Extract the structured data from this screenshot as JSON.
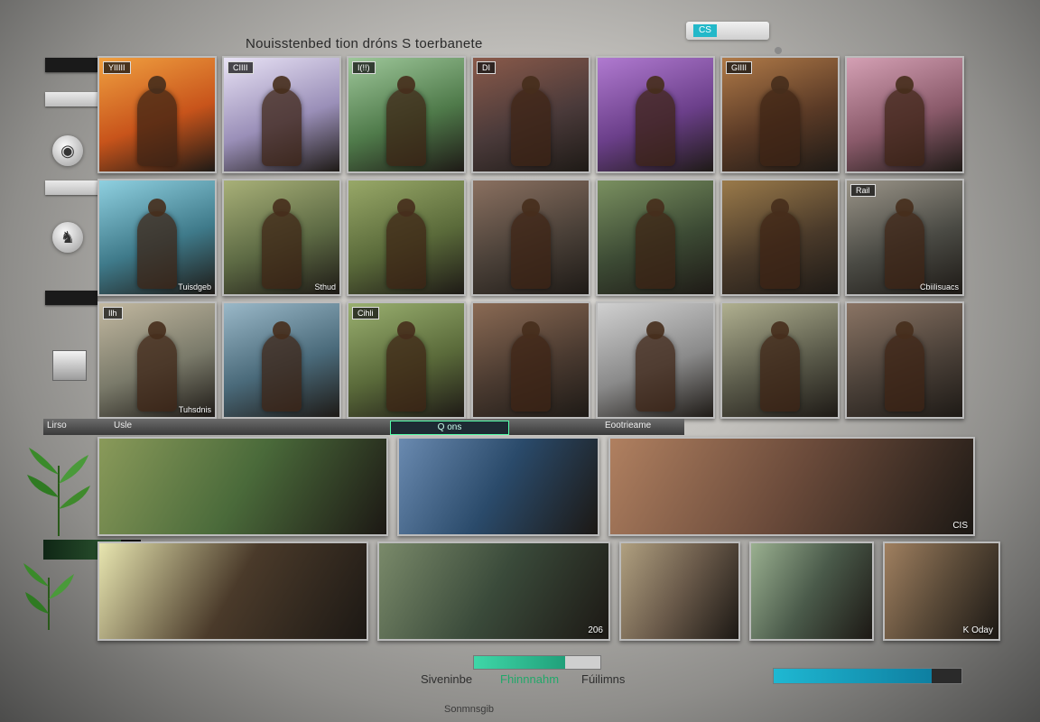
{
  "header": {
    "title": "Nouisstenbed tion dróns S toerbanete",
    "top_tag": "CS"
  },
  "sidebar": {
    "icons": [
      "globe-icon",
      "pegasus-icon",
      "monitor-icon"
    ]
  },
  "grid_rows": [
    [
      {
        "badge": "YIIIII",
        "caption": "",
        "bg": "#c8541b",
        "accent": "#f0a040"
      },
      {
        "badge": "CIIII",
        "caption": "",
        "bg": "#9a8fb8",
        "accent": "#e8e2f5"
      },
      {
        "badge": "I(!!)",
        "caption": "",
        "bg": "#4f7a4a",
        "accent": "#9ec79a"
      },
      {
        "badge": "DI",
        "caption": "",
        "bg": "#4a3a3a",
        "accent": "#8a5a4a"
      },
      {
        "badge": "",
        "caption": "",
        "bg": "#6b3f8a",
        "accent": "#b07ad0"
      },
      {
        "badge": "GIIII",
        "caption": "",
        "bg": "#5a3a26",
        "accent": "#b07a48"
      },
      {
        "badge": "",
        "caption": "",
        "bg": "#8a5a6a",
        "accent": "#d4a0b4"
      }
    ],
    [
      {
        "badge": "",
        "caption": "Tuisdgeb",
        "bg": "#3f7a8a",
        "accent": "#8fd0e0"
      },
      {
        "badge": "",
        "caption": "Sthud",
        "bg": "#5d6a44",
        "accent": "#a8b078"
      },
      {
        "badge": "",
        "caption": "",
        "bg": "#5a6a3a",
        "accent": "#98a868"
      },
      {
        "badge": "",
        "caption": "",
        "bg": "#4a4038",
        "accent": "#8a7060"
      },
      {
        "badge": "",
        "caption": "",
        "bg": "#3c4a34",
        "accent": "#7a9060"
      },
      {
        "badge": "",
        "caption": "",
        "bg": "#4a3a2a",
        "accent": "#9a7a4a"
      },
      {
        "badge": "Rail",
        "caption": "Cbiilisuacs",
        "bg": "#4a4a44",
        "accent": "#9a9488"
      }
    ],
    [
      {
        "badge": "Ilh",
        "caption": "Tuhsdnis",
        "bg": "#7a7a6a",
        "accent": "#c2b8a0"
      },
      {
        "badge": "",
        "caption": "",
        "bg": "#4a6a7a",
        "accent": "#9ab8c8"
      },
      {
        "badge": "Cihli",
        "caption": "",
        "bg": "#5a6a3a",
        "accent": "#9ab070"
      },
      {
        "badge": "",
        "caption": "",
        "bg": "#4a3a30",
        "accent": "#8a6a54"
      },
      {
        "badge": "",
        "caption": "",
        "bg": "#8a8a8a",
        "accent": "#d0d0d0"
      },
      {
        "badge": "",
        "caption": "",
        "bg": "#5a5a4a",
        "accent": "#b0b090"
      },
      {
        "badge": "",
        "caption": "",
        "bg": "#4a4038",
        "accent": "#8a7464"
      }
    ]
  ],
  "divider": {
    "left_label": "Lirso",
    "mid_label": "Usle",
    "tab_label": "Q",
    "tab_suffix": "ons",
    "right_label": "Eootrieame"
  },
  "wide_row_1": [
    {
      "caption": "",
      "badge": "",
      "bg": "#4a6a3a",
      "accent": "#8a9a5a",
      "w": 318
    },
    {
      "caption": "",
      "badge": "",
      "bg": "#2a4a6a",
      "accent": "#6a8ab0",
      "w": 220
    },
    {
      "caption": "CIS",
      "badge": "",
      "bg": "#6a4a3a",
      "accent": "#b08060",
      "w": 402
    }
  ],
  "wide_row_2": [
    {
      "caption": "",
      "badge": "",
      "bg": "#4a3a2a",
      "accent": "#e8e6b0",
      "w": 296
    },
    {
      "caption": "206",
      "badge": "",
      "bg": "#3a4a3a",
      "accent": "#7a8a6a",
      "w": 254
    },
    {
      "caption": "",
      "badge": "",
      "bg": "#6a5a4a",
      "accent": "#b0a080",
      "w": 130
    },
    {
      "caption": "",
      "badge": "",
      "bg": "#4a5a4a",
      "accent": "#9ab090",
      "w": 134
    },
    {
      "caption": "K Oday",
      "badge": "",
      "bg": "#5a4a38",
      "accent": "#a08060",
      "w": 126
    }
  ],
  "footer": {
    "left": "Siveninbe",
    "center": "Fhinnnahm",
    "right": "Fúilimns",
    "bottom": "Sonmnsgib"
  },
  "progress": {
    "center": 0.72,
    "right": 0.84
  }
}
